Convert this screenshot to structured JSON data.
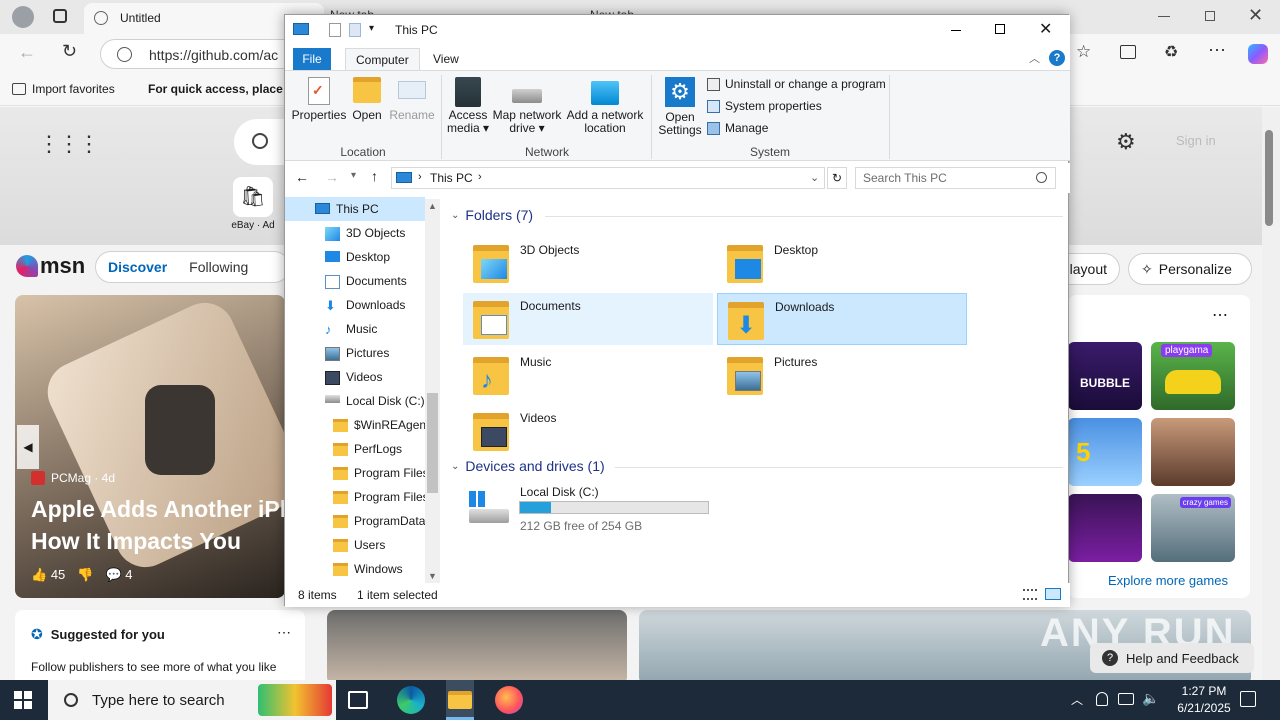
{
  "browser": {
    "tab_title": "Untitled",
    "tab2_title": "New tab",
    "tab3_title": "New tab",
    "url": "https://github.com/ac",
    "favorites": {
      "import_label": "Import favorites",
      "quick_access_text": "For quick access, place y"
    },
    "hero": {
      "shortcut_label": "eBay · Ad",
      "sign_in": "Sign in"
    },
    "msn": {
      "logo_text": "msn",
      "nav": [
        "Discover",
        "Following"
      ],
      "layout_btn": "layout",
      "personalize_btn": "Personalize",
      "article": {
        "source": "PCMag · 4d",
        "headline_1": "Apple Adds Another iPh",
        "headline_2": "How It Impacts You",
        "likes": "45",
        "comments": "4"
      },
      "suggested": {
        "title": "Suggested for you",
        "subtitle": "Follow publishers to see more of what you like"
      },
      "games": {
        "explore_link": "Explore more games",
        "tile1": "BUBBLE SHOOTER",
        "tile2": "playgama",
        "tile3": "5",
        "tile5": "crazy games"
      },
      "help_btn": "Help and Feedback"
    },
    "watermark": "ANY RUN"
  },
  "explorer": {
    "title": "This PC",
    "tabs": [
      "File",
      "Computer",
      "View"
    ],
    "ribbon": {
      "location": {
        "label": "Location",
        "buttons": [
          "Properties",
          "Open",
          "Rename"
        ]
      },
      "network": {
        "label": "Network",
        "buttons": [
          [
            "Access",
            "media ▾"
          ],
          [
            "Map network",
            "drive ▾"
          ],
          [
            "Add a network",
            "location"
          ]
        ]
      },
      "system": {
        "label": "System",
        "open_settings": [
          "Open",
          "Settings"
        ],
        "items": [
          "Uninstall or change a program",
          "System properties",
          "Manage"
        ]
      }
    },
    "address": {
      "path": "This PC",
      "search_placeholder": "Search This PC"
    },
    "nav_items": [
      {
        "label": "This PC",
        "indent": 0,
        "icon": "pc-icon",
        "selected": true
      },
      {
        "label": "3D Objects",
        "indent": 1,
        "icon": "3d-objects-icon"
      },
      {
        "label": "Desktop",
        "indent": 1,
        "icon": "desktop-icon"
      },
      {
        "label": "Documents",
        "indent": 1,
        "icon": "documents-icon"
      },
      {
        "label": "Downloads",
        "indent": 1,
        "icon": "downloads-icon"
      },
      {
        "label": "Music",
        "indent": 1,
        "icon": "music-icon"
      },
      {
        "label": "Pictures",
        "indent": 1,
        "icon": "pictures-icon"
      },
      {
        "label": "Videos",
        "indent": 1,
        "icon": "videos-icon"
      },
      {
        "label": "Local Disk (C:)",
        "indent": 1,
        "icon": "drive-icon"
      },
      {
        "label": "$WinREAgent",
        "indent": 2,
        "icon": "folder-icon"
      },
      {
        "label": "PerfLogs",
        "indent": 2,
        "icon": "folder-icon"
      },
      {
        "label": "Program Files",
        "indent": 2,
        "icon": "folder-icon"
      },
      {
        "label": "Program Files",
        "indent": 2,
        "icon": "folder-icon"
      },
      {
        "label": "ProgramData",
        "indent": 2,
        "icon": "folder-icon"
      },
      {
        "label": "Users",
        "indent": 2,
        "icon": "folder-icon"
      },
      {
        "label": "Windows",
        "indent": 2,
        "icon": "folder-icon"
      }
    ],
    "folders_header": "Folders (7)",
    "folders": [
      {
        "label": "3D Objects",
        "state": "none"
      },
      {
        "label": "Desktop",
        "state": "none"
      },
      {
        "label": "Documents",
        "state": "hover"
      },
      {
        "label": "Downloads",
        "state": "selected"
      },
      {
        "label": "Music",
        "state": "none"
      },
      {
        "label": "Pictures",
        "state": "none"
      },
      {
        "label": "Videos",
        "state": "none"
      }
    ],
    "drives_header": "Devices and drives (1)",
    "drive": {
      "label": "Local Disk (C:)",
      "free_text": "212 GB free of 254 GB",
      "used_fraction": 0.165
    },
    "status": {
      "count": "8 items",
      "selection": "1 item selected"
    }
  },
  "taskbar": {
    "search_placeholder": "Type here to search",
    "time": "1:27 PM",
    "date": "6/21/2025"
  },
  "colors": {
    "accent": "#0078d4",
    "selected_bg": "#cce8ff",
    "hover_bg": "#e5f3ff",
    "taskbar": "#1c2a3a"
  }
}
